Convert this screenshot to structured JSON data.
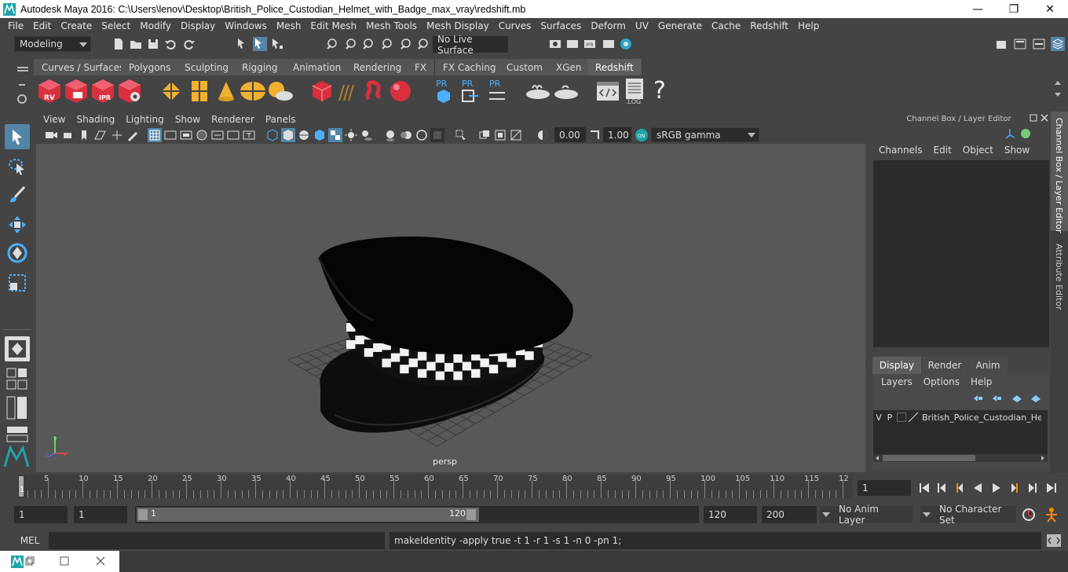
{
  "window": {
    "title": "Autodesk Maya 2016: C:\\Users\\lenov\\Desktop\\British_Police_Custodian_Helmet_with_Badge_max_vray\\redshift.mb",
    "minimize": "—",
    "maximize": "❐",
    "close": "✕"
  },
  "menubar": [
    "File",
    "Edit",
    "Create",
    "Select",
    "Modify",
    "Display",
    "Windows",
    "Mesh",
    "Edit Mesh",
    "Mesh Tools",
    "Mesh Display",
    "Curves",
    "Surfaces",
    "Deform",
    "UV",
    "Generate",
    "Cache",
    "Redshift",
    "Help"
  ],
  "statusline": {
    "mode": "Modeling",
    "live_surface": "No Live Surface"
  },
  "shelf_tabs": [
    "Curves / Surfaces",
    "Polygons",
    "Sculpting",
    "Rigging",
    "Animation",
    "Rendering",
    "FX",
    "FX Caching",
    "Custom",
    "XGen",
    "Redshift"
  ],
  "shelf_active": "Redshift",
  "shelf_labels": {
    "rv": "RV",
    "ipr": "IPR",
    "pr1": "PR",
    "pr2": "PR",
    "pr3": "PR",
    "log": ".LOG",
    "help": "?"
  },
  "viewport": {
    "menus": [
      "View",
      "Shading",
      "Lighting",
      "Show",
      "Renderer",
      "Panels"
    ],
    "exposure": "0.00",
    "gamma": "1.00",
    "color_space": "sRGB gamma",
    "camera_label": "persp"
  },
  "channel_box": {
    "title": "Channel Box / Layer Editor",
    "menus": [
      "Channels",
      "Edit",
      "Object",
      "Show"
    ]
  },
  "layer_editor": {
    "tabs": [
      "Display",
      "Render",
      "Anim"
    ],
    "active_tab": "Display",
    "menus": [
      "Layers",
      "Options",
      "Help"
    ],
    "layer": {
      "v": "V",
      "p": "P",
      "name": "British_Police_Custodian_Helm"
    }
  },
  "side_tabs": [
    "Channel Box / Layer Editor",
    "Attribute Editor"
  ],
  "timeline": {
    "ticks": [
      "5",
      "10",
      "15",
      "20",
      "25",
      "30",
      "35",
      "40",
      "45",
      "50",
      "55",
      "60",
      "65",
      "70",
      "75",
      "80",
      "85",
      "90",
      "95",
      "100",
      "105",
      "110",
      "115",
      "12"
    ],
    "start_marker": "1",
    "current_frame": "1"
  },
  "range": {
    "start": "1",
    "playback_start": "1",
    "slider_start": "1",
    "slider_end": "120",
    "playback_end": "120",
    "end": "200",
    "anim_layer": "No Anim Layer",
    "character_set": "No Character Set"
  },
  "command_line": {
    "lang": "MEL",
    "input": "",
    "result": "makeIdentity -apply true -t 1 -r 1 -s 1 -n 0 -pn 1;"
  },
  "colors": {
    "accent": "#5285a6",
    "selected_tool": "#5285a6",
    "redshift_red": "#d8303c"
  }
}
